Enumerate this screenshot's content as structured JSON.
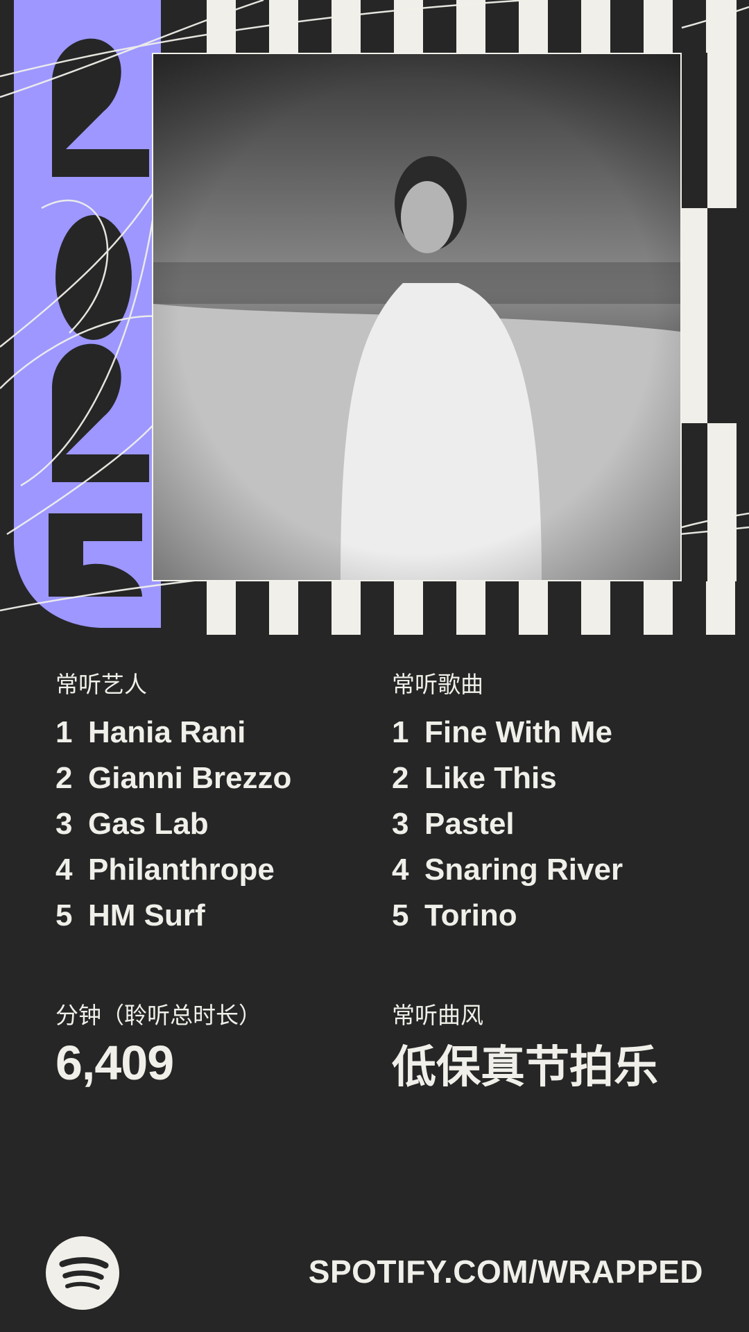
{
  "year": "2025",
  "colors": {
    "background": "#262626",
    "accent": "#9d97ff",
    "text": "#f0efe9"
  },
  "top_artists": {
    "label": "常听艺人",
    "items": [
      {
        "rank": "1",
        "name": "Hania Rani"
      },
      {
        "rank": "2",
        "name": "Gianni Brezzo"
      },
      {
        "rank": "3",
        "name": "Gas Lab"
      },
      {
        "rank": "4",
        "name": "Philanthrope"
      },
      {
        "rank": "5",
        "name": "HM Surf"
      }
    ]
  },
  "top_songs": {
    "label": "常听歌曲",
    "items": [
      {
        "rank": "1",
        "name": "Fine With Me"
      },
      {
        "rank": "2",
        "name": "Like This"
      },
      {
        "rank": "3",
        "name": "Pastel"
      },
      {
        "rank": "4",
        "name": "Snaring River"
      },
      {
        "rank": "5",
        "name": "Torino"
      }
    ]
  },
  "minutes": {
    "label": "分钟（聆听总时长）",
    "value": "6,409"
  },
  "top_genre": {
    "label": "常听曲风",
    "value": "低保真节拍乐"
  },
  "footer": {
    "logo_icon": "spotify-logo-icon",
    "url": "SPOTIFY.COM/WRAPPED"
  }
}
